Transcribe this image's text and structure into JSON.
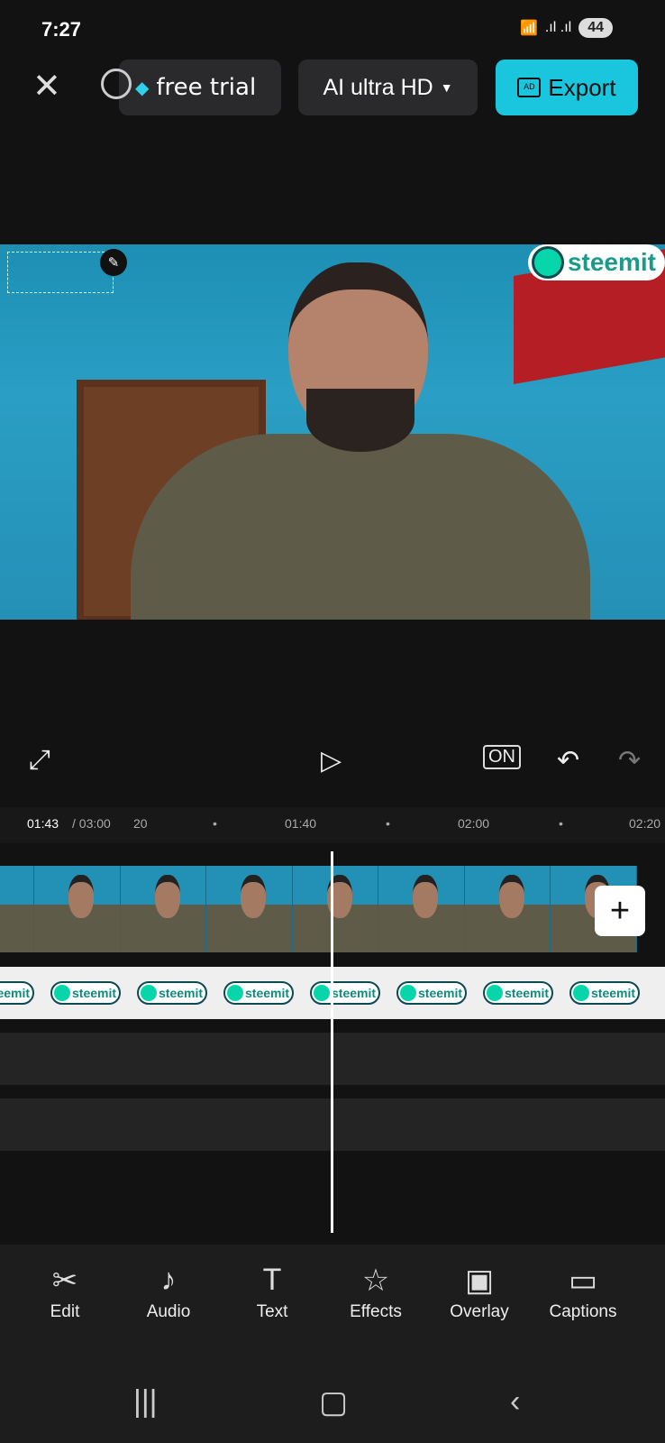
{
  "status": {
    "time": "7:27",
    "battery": "44",
    "icons": [
      "wifi-icon",
      "signal-icon",
      "signal-icon"
    ]
  },
  "topbar": {
    "free_trial": "free trial",
    "quality": "AI ultra HD",
    "export": "Export",
    "export_badge": "AD"
  },
  "preview": {
    "watermark": "steemit"
  },
  "controls": {
    "on_label": "ON"
  },
  "timeline": {
    "current": "01:43",
    "total": "/ 03:00",
    "ticks": [
      "20",
      "•",
      "01:40",
      "•",
      "02:00",
      "•",
      "02:20"
    ],
    "sticker_text": "steemit"
  },
  "toolbar": [
    {
      "icon": "scissors-icon",
      "label": "Edit"
    },
    {
      "icon": "music-note-icon",
      "label": "Audio"
    },
    {
      "icon": "text-icon",
      "label": "Text"
    },
    {
      "icon": "star-icon",
      "label": "Effects"
    },
    {
      "icon": "overlay-icon",
      "label": "Overlay"
    },
    {
      "icon": "captions-icon",
      "label": "Captions"
    }
  ]
}
